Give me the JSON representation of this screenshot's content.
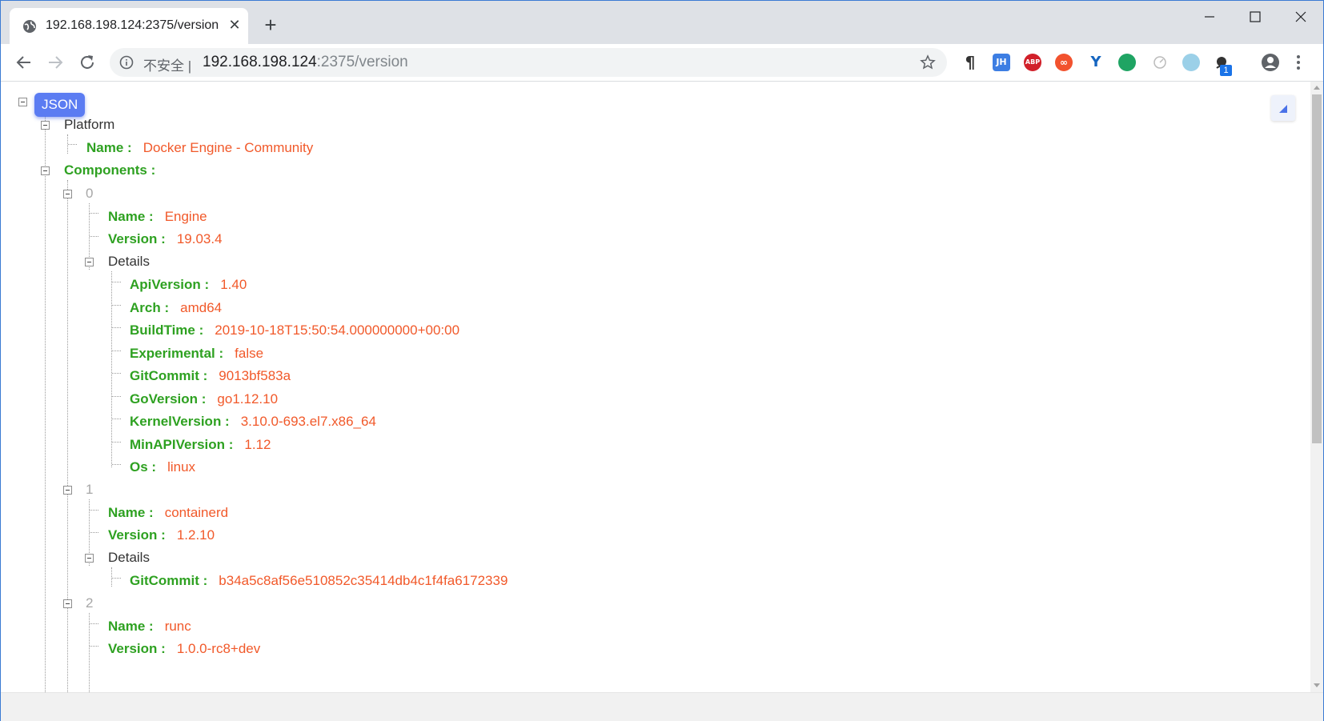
{
  "tab": {
    "title": "192.168.198.124:2375/version",
    "close": "✕"
  },
  "new_tab": "+",
  "omnibox": {
    "security": "不安全",
    "separator": "|",
    "host": "192.168.198.124",
    "rest": ":2375/version"
  },
  "extensions": [
    {
      "name": "pilcrow-extension-icon",
      "label": "¶"
    },
    {
      "name": "jh-extension-icon",
      "label": "JH"
    },
    {
      "name": "adblock-plus-icon",
      "label": "ABP"
    },
    {
      "name": "infinity-extension-icon",
      "label": "∞"
    },
    {
      "name": "y-extension-icon",
      "label": "Y"
    },
    {
      "name": "green-extension-icon",
      "label": ""
    },
    {
      "name": "gray-extension-icon",
      "label": ""
    },
    {
      "name": "face-extension-icon",
      "label": ""
    },
    {
      "name": "octotree-extension-icon",
      "label": ""
    }
  ],
  "badge_count": "1",
  "json_viewer": {
    "root_label": "JSON",
    "platform": {
      "label": "Platform",
      "name_key": "Name :",
      "name_val": "Docker Engine - Community"
    },
    "components_key": "Components :",
    "details_label": "Details",
    "components": [
      {
        "index": "0",
        "name_key": "Name :",
        "name_val": "Engine",
        "version_key": "Version :",
        "version_val": "19.03.4",
        "details": [
          {
            "k": "ApiVersion :",
            "v": "1.40"
          },
          {
            "k": "Arch :",
            "v": "amd64"
          },
          {
            "k": "BuildTime :",
            "v": "2019-10-18T15:50:54.000000000+00:00"
          },
          {
            "k": "Experimental :",
            "v": "false"
          },
          {
            "k": "GitCommit :",
            "v": "9013bf583a"
          },
          {
            "k": "GoVersion :",
            "v": "go1.12.10"
          },
          {
            "k": "KernelVersion :",
            "v": "3.10.0-693.el7.x86_64"
          },
          {
            "k": "MinAPIVersion :",
            "v": "1.12"
          },
          {
            "k": "Os :",
            "v": "linux"
          }
        ]
      },
      {
        "index": "1",
        "name_key": "Name :",
        "name_val": "containerd",
        "version_key": "Version :",
        "version_val": "1.2.10",
        "details": [
          {
            "k": "GitCommit :",
            "v": "b34a5c8af56e510852c35414db4c1f4fa6172339"
          }
        ]
      },
      {
        "index": "2",
        "name_key": "Name :",
        "name_val": "runc",
        "version_key": "Version :",
        "version_val": "1.0.0-rc8+dev",
        "details": []
      }
    ]
  }
}
